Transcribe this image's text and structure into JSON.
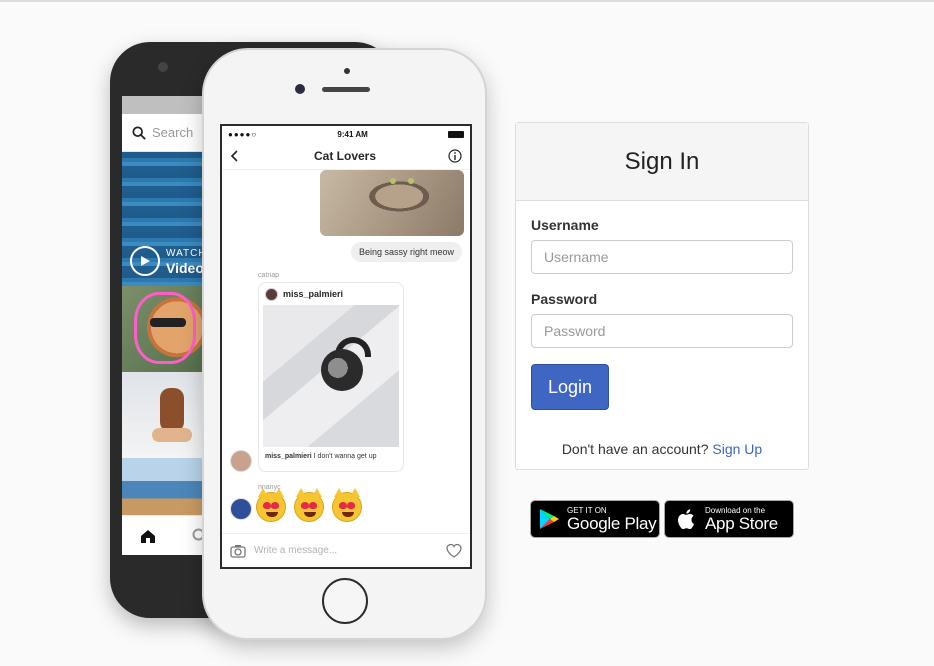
{
  "phone_back": {
    "search_placeholder": "Search",
    "watch_label": "WATCH",
    "video_label": "Video"
  },
  "phone_front": {
    "status_time": "9:41 AM",
    "chat_title": "Cat Lovers",
    "bubble_text": "Being sassy right meow",
    "sender_1": "catnap",
    "shared_post_user": "miss_palmieri",
    "shared_caption_user": "miss_palmieri",
    "shared_caption_text": "I don't wanna get up",
    "sender_2": "nnanyc",
    "compose_placeholder": "Write a message..."
  },
  "signin": {
    "title": "Sign In",
    "username_label": "Username",
    "username_placeholder": "Username",
    "password_label": "Password",
    "password_placeholder": "Password",
    "login_button": "Login",
    "no_account_text": "Don't have an account?",
    "signup_link": "Sign Up"
  },
  "badges": {
    "google_small": "GET IT ON",
    "google_big": "Google Play",
    "apple_small": "Download on the",
    "apple_big": "App Store"
  },
  "colors": {
    "login_button": "#3f66c2",
    "link": "#3b67b8",
    "page_background": "#fafafa"
  }
}
